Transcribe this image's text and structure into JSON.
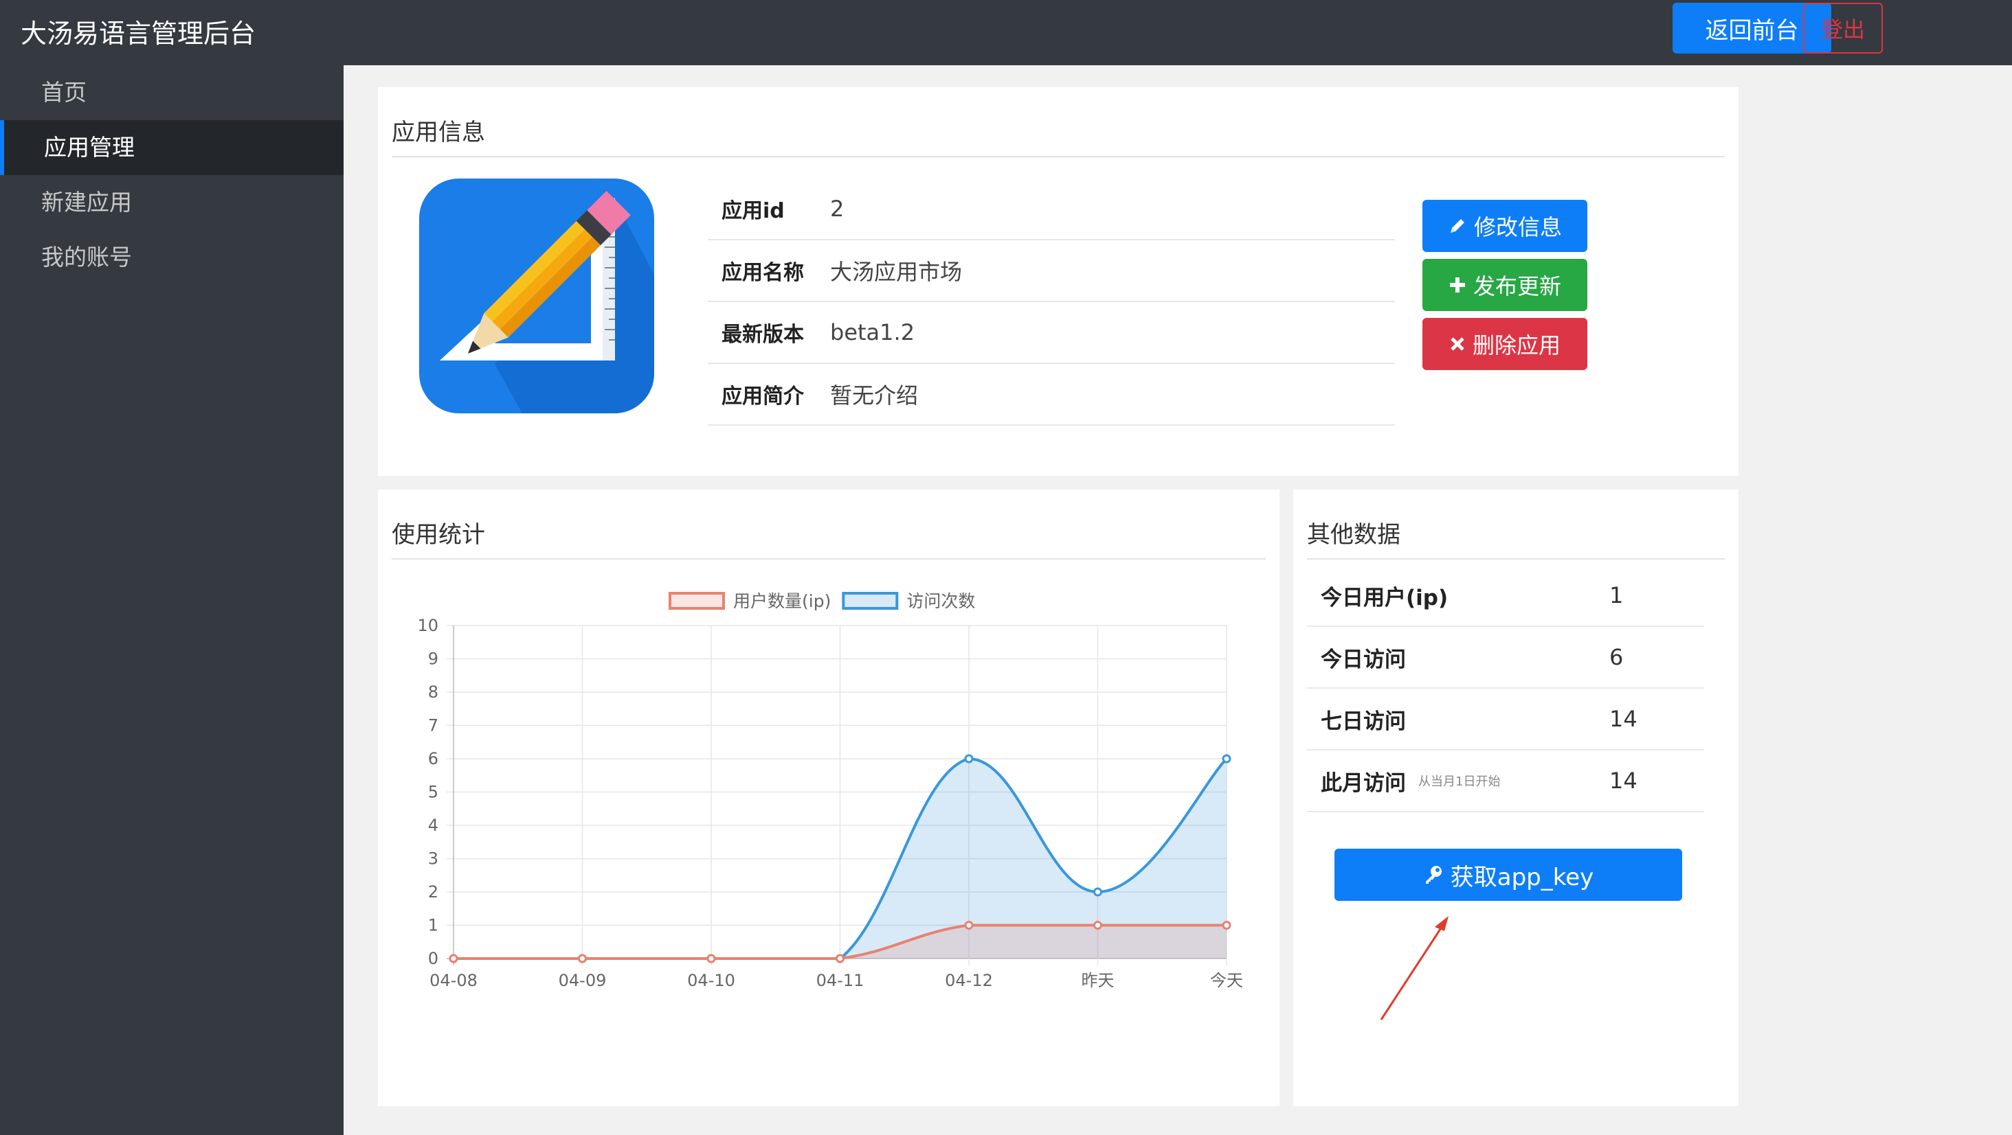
{
  "header": {
    "brand": "大汤易语言管理后台",
    "front_button": "返回前台",
    "logout_button": "登出"
  },
  "sidebar": {
    "items": [
      {
        "label": "首页",
        "active": false
      },
      {
        "label": "应用管理",
        "active": true
      },
      {
        "label": "新建应用",
        "active": false
      },
      {
        "label": "我的账号",
        "active": false
      }
    ]
  },
  "app_info": {
    "title": "应用信息",
    "icon": "pencil-ruler-app-icon",
    "rows": [
      {
        "key": "应用id",
        "value": "2"
      },
      {
        "key": "应用名称",
        "value": "大汤应用市场"
      },
      {
        "key": "最新版本",
        "value": "beta1.2"
      },
      {
        "key": "应用简介",
        "value": "暂无介绍"
      }
    ],
    "buttons": {
      "edit": "修改信息",
      "publish": "发布更新",
      "delete": "删除应用"
    }
  },
  "usage": {
    "title": "使用统计"
  },
  "other": {
    "title": "其他数据",
    "rows": [
      {
        "key": "今日用户(ip)",
        "value": "1",
        "note": ""
      },
      {
        "key": "今日访问",
        "value": "6",
        "note": ""
      },
      {
        "key": "七日访问",
        "value": "14",
        "note": ""
      },
      {
        "key": "此月访问",
        "value": "14",
        "note": "从当月1日开始"
      }
    ],
    "key_button": "获取app_key"
  },
  "colors": {
    "primary": "#0d7ef7",
    "success": "#28a745",
    "danger": "#dc3545",
    "dark": "#343a40",
    "series_users": "#e8826f",
    "series_visits": "#3a97db"
  },
  "chart_data": {
    "type": "line",
    "categories": [
      "04-08",
      "04-09",
      "04-10",
      "04-11",
      "04-12",
      "昨天",
      "今天"
    ],
    "series": [
      {
        "name": "用户数量(ip)",
        "values": [
          0,
          0,
          0,
          0,
          1,
          1,
          1
        ],
        "color": "#e8826f",
        "fill": "rgba(232,130,111,0.2)"
      },
      {
        "name": "访问次数",
        "values": [
          0,
          0,
          0,
          0,
          6,
          2,
          6
        ],
        "color": "#3a97db",
        "fill": "rgba(58,151,219,0.2)"
      }
    ],
    "ylim": [
      0,
      10
    ],
    "yticks": [
      "0",
      "1",
      "2",
      "3",
      "4",
      "5",
      "6",
      "7",
      "8",
      "9",
      "10"
    ],
    "smooth": true,
    "grid": true,
    "legend": "top-center"
  }
}
